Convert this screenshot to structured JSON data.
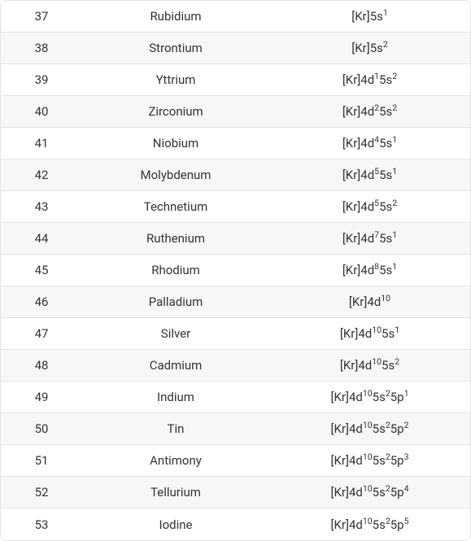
{
  "rows": [
    {
      "atomic_number": "37",
      "name": "Rubidium",
      "core": "[Kr]",
      "sub": [
        {
          "orb": "5s",
          "exp": "1"
        }
      ]
    },
    {
      "atomic_number": "38",
      "name": "Strontium",
      "core": "[Kr]",
      "sub": [
        {
          "orb": "5s",
          "exp": "2"
        }
      ]
    },
    {
      "atomic_number": "39",
      "name": "Yttrium",
      "core": "[Kr]",
      "sub": [
        {
          "orb": "4d",
          "exp": "1"
        },
        {
          "orb": "5s",
          "exp": "2"
        }
      ]
    },
    {
      "atomic_number": "40",
      "name": "Zirconium",
      "core": "[Kr]",
      "sub": [
        {
          "orb": "4d",
          "exp": "2"
        },
        {
          "orb": "5s",
          "exp": "2"
        }
      ]
    },
    {
      "atomic_number": "41",
      "name": "Niobium",
      "core": "[Kr]",
      "sub": [
        {
          "orb": "4d",
          "exp": "4"
        },
        {
          "orb": "5s",
          "exp": "1"
        }
      ]
    },
    {
      "atomic_number": "42",
      "name": "Molybdenum",
      "core": "[Kr]",
      "sub": [
        {
          "orb": "4d",
          "exp": "5"
        },
        {
          "orb": "5s",
          "exp": "1"
        }
      ]
    },
    {
      "atomic_number": "43",
      "name": "Technetium",
      "core": "[Kr]",
      "sub": [
        {
          "orb": "4d",
          "exp": "5"
        },
        {
          "orb": "5s",
          "exp": "2"
        }
      ]
    },
    {
      "atomic_number": "44",
      "name": "Ruthenium",
      "core": "[Kr]",
      "sub": [
        {
          "orb": "4d",
          "exp": "7"
        },
        {
          "orb": "5s",
          "exp": "1"
        }
      ]
    },
    {
      "atomic_number": "45",
      "name": "Rhodium",
      "core": "[Kr]",
      "sub": [
        {
          "orb": "4d",
          "exp": "8"
        },
        {
          "orb": "5s",
          "exp": "1"
        }
      ]
    },
    {
      "atomic_number": "46",
      "name": "Palladium",
      "core": "[Kr]",
      "sub": [
        {
          "orb": "4d",
          "exp": "10"
        }
      ]
    },
    {
      "atomic_number": "47",
      "name": "Silver",
      "core": "[Kr]",
      "sub": [
        {
          "orb": "4d",
          "exp": "10"
        },
        {
          "orb": "5s",
          "exp": "1"
        }
      ]
    },
    {
      "atomic_number": "48",
      "name": "Cadmium",
      "core": "[Kr]",
      "sub": [
        {
          "orb": "4d",
          "exp": "10"
        },
        {
          "orb": "5s",
          "exp": "2"
        }
      ]
    },
    {
      "atomic_number": "49",
      "name": "Indium",
      "core": "[Kr]",
      "sub": [
        {
          "orb": "4d",
          "exp": "10"
        },
        {
          "orb": "5s",
          "exp": "2"
        },
        {
          "orb": "5p",
          "exp": "1"
        }
      ]
    },
    {
      "atomic_number": "50",
      "name": "Tin",
      "core": "[Kr]",
      "sub": [
        {
          "orb": "4d",
          "exp": "10"
        },
        {
          "orb": "5s",
          "exp": "2"
        },
        {
          "orb": "5p",
          "exp": "2"
        }
      ]
    },
    {
      "atomic_number": "51",
      "name": "Antimony",
      "core": "[Kr]",
      "sub": [
        {
          "orb": "4d",
          "exp": "10"
        },
        {
          "orb": "5s",
          "exp": "2"
        },
        {
          "orb": "5p",
          "exp": "3"
        }
      ]
    },
    {
      "atomic_number": "52",
      "name": "Tellurium",
      "core": "[Kr]",
      "sub": [
        {
          "orb": "4d",
          "exp": "10"
        },
        {
          "orb": "5s",
          "exp": "2"
        },
        {
          "orb": "5p",
          "exp": "4"
        }
      ]
    },
    {
      "atomic_number": "53",
      "name": "Iodine",
      "core": "[Kr]",
      "sub": [
        {
          "orb": "4d",
          "exp": "10"
        },
        {
          "orb": "5s",
          "exp": "2"
        },
        {
          "orb": "5p",
          "exp": "5"
        }
      ]
    }
  ]
}
